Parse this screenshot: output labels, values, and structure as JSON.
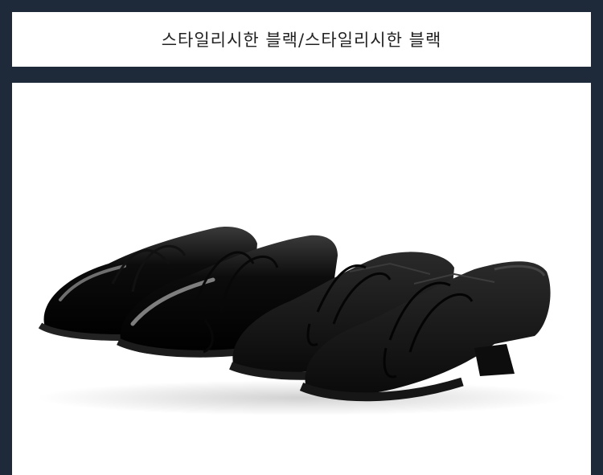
{
  "header": {
    "title": "스타일리시한 블랙/스타일리시한 블랙"
  },
  "colors": {
    "background": "#1e2a3a",
    "panel": "#ffffff",
    "shoe": "#111111"
  },
  "photo": {
    "subject": "black-dance-shoes"
  }
}
